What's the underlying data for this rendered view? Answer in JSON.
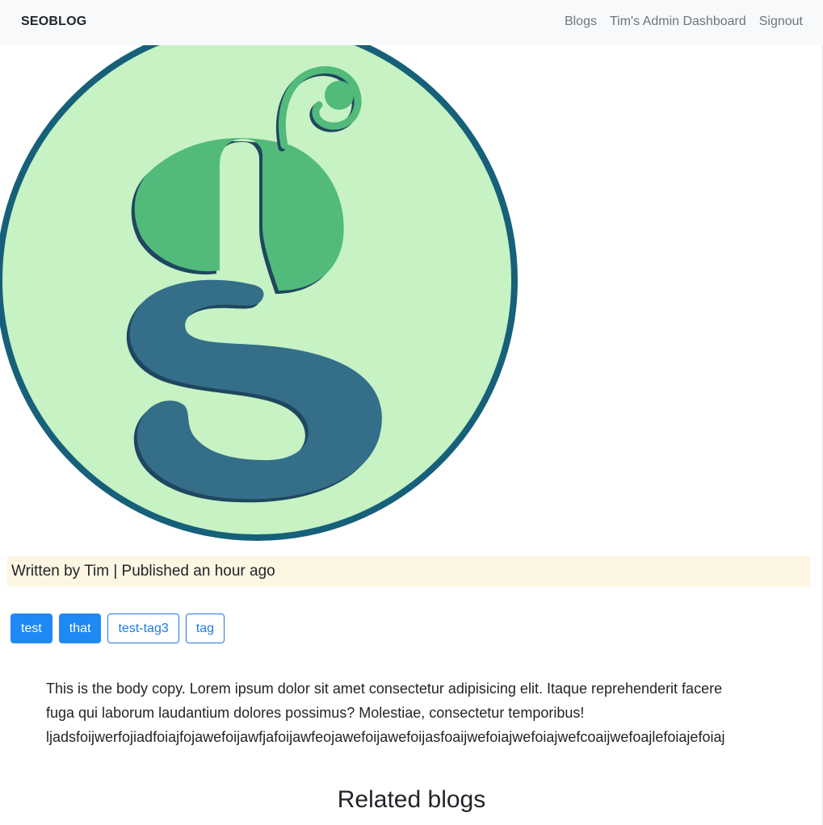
{
  "navbar": {
    "brand": "SEOBLOG",
    "links": [
      {
        "label": "Blogs"
      },
      {
        "label": "Tim's Admin Dashboard"
      },
      {
        "label": "Signout"
      }
    ]
  },
  "post": {
    "meta": "Written by Tim | Published an hour ago",
    "tags": [
      {
        "label": "test",
        "style": "filled"
      },
      {
        "label": "that",
        "style": "filled"
      },
      {
        "label": "test-tag3",
        "style": "outline"
      },
      {
        "label": "tag",
        "style": "outline"
      }
    ],
    "body_lines": [
      "This is the body copy. Lorem ipsum dolor sit amet consectetur adipisicing elit. Itaque reprehenderit facere",
      "fuga qui laborum laudantium dolores possimus? Molestiae, consectetur temporibus!",
      "ljadsfoijwerfojiadfoiajfojawefoijawfjafoijawfeojawefoijawefoijasfoaijwefoiajwefoiajwefcoaijwefoajlefoiajefoiaj"
    ]
  },
  "related": {
    "heading": "Related blogs"
  },
  "colors": {
    "logo_ring": "#17607a",
    "logo_fill": "#c6f2c4",
    "leaf_green": "#52ba7a",
    "s_blue": "#346e88",
    "tag_primary": "#1e88f5",
    "meta_bg": "#fdf6e3"
  }
}
